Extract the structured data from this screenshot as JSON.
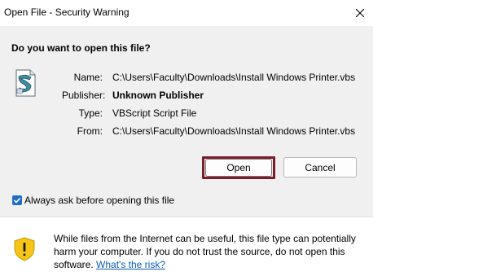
{
  "window": {
    "title": "Open File - Security Warning"
  },
  "question": "Do you want to open this file?",
  "file_info": {
    "name_label": "Name:",
    "name_value": "C:\\Users\\Faculty\\Downloads\\Install Windows Printer.vbs",
    "publisher_label": "Publisher:",
    "publisher_value": "Unknown Publisher",
    "type_label": "Type:",
    "type_value": "VBScript Script File",
    "from_label": "From:",
    "from_value": "C:\\Users\\Faculty\\Downloads\\Install Windows Printer.vbs"
  },
  "buttons": {
    "open_label": "Open",
    "cancel_label": "Cancel"
  },
  "checkbox": {
    "label": "Always ask before opening this file",
    "checked": true
  },
  "warning": {
    "text": "While files from the Internet can be useful, this file type can potentially harm your computer. If you do not trust the source, do not open this software.",
    "link_text": "What's the risk?"
  },
  "icons": {
    "file": "vbscript-file-icon",
    "shield": "shield-warning-icon",
    "close": "close-icon",
    "check": "checkmark-icon"
  },
  "colors": {
    "open_highlight": "#7b1c2b",
    "checkbox_accent": "#1f6fc6",
    "shield_yellow": "#f5c518",
    "link": "#0b5cad"
  }
}
